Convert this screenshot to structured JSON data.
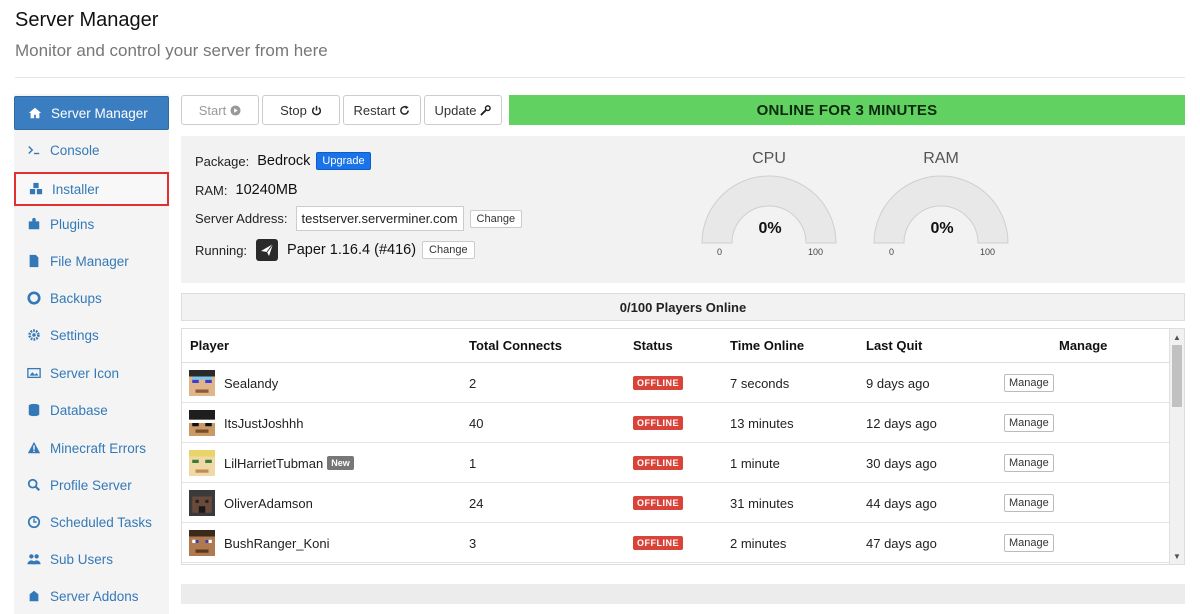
{
  "header": {
    "title": "Server Manager",
    "subtitle": "Monitor and control your server from here"
  },
  "sidebar": {
    "items": [
      {
        "label": "Server Manager",
        "icon": "home-icon"
      },
      {
        "label": "Console",
        "icon": "terminal-icon"
      },
      {
        "label": "Installer",
        "icon": "cubes-icon"
      },
      {
        "label": "Plugins",
        "icon": "puzzle-icon"
      },
      {
        "label": "File Manager",
        "icon": "file-icon"
      },
      {
        "label": "Backups",
        "icon": "lifebuoy-icon"
      },
      {
        "label": "Settings",
        "icon": "gear-icon"
      },
      {
        "label": "Server Icon",
        "icon": "image-icon"
      },
      {
        "label": "Database",
        "icon": "database-icon"
      },
      {
        "label": "Minecraft Errors",
        "icon": "warning-icon"
      },
      {
        "label": "Profile Server",
        "icon": "search-icon"
      },
      {
        "label": "Scheduled Tasks",
        "icon": "clock-icon"
      },
      {
        "label": "Sub Users",
        "icon": "users-icon"
      },
      {
        "label": "Server Addons",
        "icon": "addon-icon"
      }
    ]
  },
  "toolbar": {
    "start_label": "Start",
    "stop_label": "Stop",
    "restart_label": "Restart",
    "update_label": "Update",
    "status_text": "ONLINE FOR 3 MINUTES",
    "status_color": "#61d161"
  },
  "info": {
    "package_label": "Package:",
    "package_value": "Bedrock",
    "upgrade_label": "Upgrade",
    "ram_label": "RAM:",
    "ram_value": "10240MB",
    "address_label": "Server Address:",
    "address_value": "testserver.serverminer.com",
    "address_change_label": "Change",
    "running_label": "Running:",
    "running_value": "Paper 1.16.4 (#416)",
    "running_change_label": "Change"
  },
  "gauges": {
    "cpu": {
      "label": "CPU",
      "value": "0%",
      "min": "0",
      "max": "100"
    },
    "ram": {
      "label": "RAM",
      "value": "0%",
      "min": "0",
      "max": "100"
    }
  },
  "players": {
    "summary": "0/100 Players Online",
    "columns": [
      "Player",
      "Total Connects",
      "Status",
      "Time Online",
      "Last Quit",
      "Manage"
    ],
    "rows": [
      {
        "name": "Sealandy",
        "connects": "2",
        "status": "OFFLINE",
        "time_online": "7 seconds",
        "last_quit": "9 days ago",
        "manage": "Manage",
        "new": ""
      },
      {
        "name": "ItsJustJoshhh",
        "connects": "40",
        "status": "OFFLINE",
        "time_online": "13 minutes",
        "last_quit": "12 days ago",
        "manage": "Manage",
        "new": ""
      },
      {
        "name": "LilHarrietTubman",
        "connects": "1",
        "status": "OFFLINE",
        "time_online": "1 minute",
        "last_quit": "30 days ago",
        "manage": "Manage",
        "new": "New"
      },
      {
        "name": "OliverAdamson",
        "connects": "24",
        "status": "OFFLINE",
        "time_online": "31 minutes",
        "last_quit": "44 days ago",
        "manage": "Manage",
        "new": ""
      },
      {
        "name": "BushRanger_Koni",
        "connects": "3",
        "status": "OFFLINE",
        "time_online": "2 minutes",
        "last_quit": "47 days ago",
        "manage": "Manage",
        "new": ""
      }
    ]
  }
}
